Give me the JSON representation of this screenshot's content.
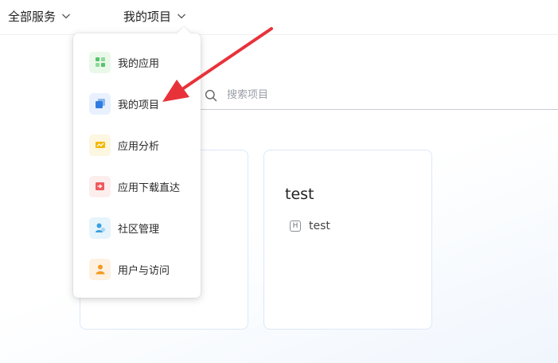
{
  "nav": {
    "all_services": "全部服务",
    "my_projects": "我的项目"
  },
  "dropdown": {
    "items": [
      {
        "label": "我的应用",
        "icon": "apps-icon",
        "bg": "#eaf8ea",
        "color": "#56c46b"
      },
      {
        "label": "我的项目",
        "icon": "project-icon",
        "bg": "#e8f1fd",
        "color": "#2f7de1"
      },
      {
        "label": "应用分析",
        "icon": "analytics-icon",
        "bg": "#fdf6e0",
        "color": "#f5b800"
      },
      {
        "label": "应用下载直达",
        "icon": "download-icon",
        "bg": "#fdeeee",
        "color": "#f0595c"
      },
      {
        "label": "社区管理",
        "icon": "community-icon",
        "bg": "#e6f4fb",
        "color": "#3aa0e0"
      },
      {
        "label": "用户与访问",
        "icon": "user-icon",
        "bg": "#fdf1e2",
        "color": "#f59a23"
      }
    ]
  },
  "search": {
    "placeholder": "搜索项目"
  },
  "cards": [
    {
      "title": "",
      "meta": ""
    },
    {
      "title": "test",
      "badge": "H",
      "meta": "test"
    }
  ],
  "colors": {
    "annotation_arrow": "#e8323a"
  }
}
